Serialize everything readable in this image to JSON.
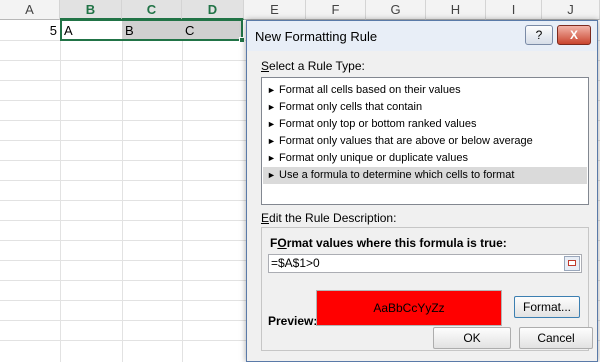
{
  "sheet": {
    "columns": [
      "A",
      "B",
      "C",
      "D",
      "E",
      "F",
      "G",
      "H",
      "I",
      "J"
    ],
    "selected_columns": [
      "B",
      "C",
      "D"
    ],
    "row1": {
      "a": "5",
      "b": "A",
      "c": "B",
      "d": "C"
    }
  },
  "dialog": {
    "title": "New Formatting Rule",
    "help_label": "?",
    "close_label": "X",
    "select_type_label_underlined": "S",
    "select_type_label_rest": "elect a Rule Type:",
    "rule_types": [
      "Format all cells based on their values",
      "Format only cells that contain",
      "Format only top or bottom ranked values",
      "Format only values that are above or below average",
      "Format only unique or duplicate values",
      "Use a formula to determine which cells to format"
    ],
    "selected_rule_index": 5,
    "arrow_glyph": "►",
    "edit_desc_label_underlined": "E",
    "edit_desc_label_rest": "dit the Rule Description:",
    "formula_heading_underlined": "O",
    "formula_heading_before": "F",
    "formula_heading_after": "rmat values where this formula is true:",
    "formula_value": "=$A$1>0",
    "preview_label": "Preview:",
    "preview_text": "AaBbCcYyZz",
    "preview_fill": "#ff0000",
    "format_button_label": "Format...",
    "ok_label": "OK",
    "cancel_label": "Cancel"
  },
  "colors": {
    "accent_green": "#217346",
    "preview_fill": "#ff0000"
  }
}
